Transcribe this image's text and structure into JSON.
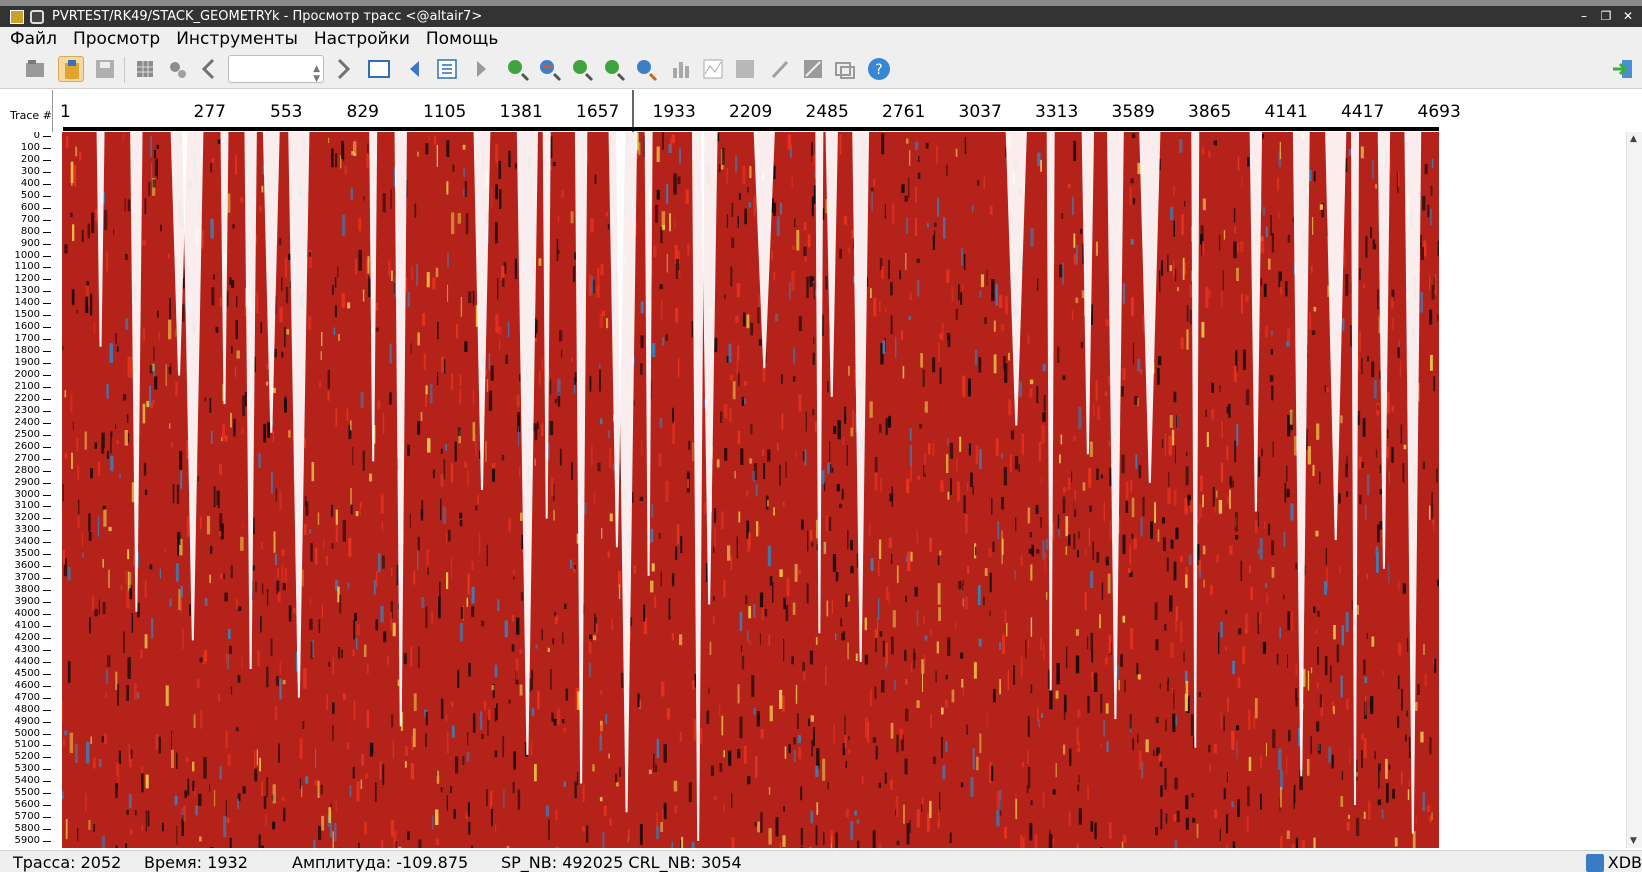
{
  "window": {
    "title": "PVRTEST/RK49/STACK_GEOMETRYk - Просмотр трасс <@altair7>",
    "buttons": [
      "–",
      "❐",
      "✕"
    ]
  },
  "menu": [
    "Файл",
    "Просмотр",
    "Инструменты",
    "Настройки",
    "Помощь"
  ],
  "toolbar": {
    "combo_value": "",
    "icons": [
      "open-folder-icon",
      "import-icon",
      "save-icon",
      "grid-icon",
      "settings-icon",
      "chevron-left-icon",
      "chevron-right-icon",
      "window-icon",
      "play-back-icon",
      "list-icon",
      "play-forward-icon",
      "zoom-in-icon",
      "zoom-out-icon",
      "zoom-up-icon",
      "zoom-fit-icon",
      "zoom-reset-icon",
      "bar-chart-icon",
      "spectrum-icon",
      "image-icon",
      "pick-icon",
      "edit-icon",
      "overlay-icon",
      "help-icon",
      "exit-icon"
    ]
  },
  "trace_axis": {
    "label": "Trace #",
    "ticks": [
      "1",
      "277",
      "553",
      "829",
      "1105",
      "1381",
      "1657",
      "1933",
      "2209",
      "2485",
      "2761",
      "3037",
      "3313",
      "3589",
      "3865",
      "4141",
      "4417",
      "4693"
    ]
  },
  "time_axis": {
    "ticks": [
      "0",
      "100",
      "200",
      "300",
      "400",
      "500",
      "600",
      "700",
      "800",
      "900",
      "1000",
      "1100",
      "1200",
      "1300",
      "1400",
      "1500",
      "1600",
      "1700",
      "1800",
      "1900",
      "2000",
      "2100",
      "2200",
      "2300",
      "2400",
      "2500",
      "2600",
      "2700",
      "2800",
      "2900",
      "3000",
      "3100",
      "3200",
      "3300",
      "3400",
      "3500",
      "3600",
      "3700",
      "3800",
      "3900",
      "4000",
      "4100",
      "4200",
      "4300",
      "4400",
      "4500",
      "4600",
      "4700",
      "4800",
      "4900",
      "5000",
      "5100",
      "5200",
      "5300",
      "5400",
      "5500",
      "5600",
      "5700",
      "5800",
      "5900"
    ]
  },
  "plot": {
    "colors": {
      "dominant": "#b5221a",
      "dark": "#1a0a0a",
      "bright": "#e8331e",
      "accent_blue": "#3d7fb8",
      "accent_yellow": "#e9c44a",
      "gap": "#ffffff"
    },
    "gap_fractions": [
      0.028,
      0.054,
      0.085,
      0.095,
      0.118,
      0.137,
      0.152,
      0.172,
      0.226,
      0.246,
      0.305,
      0.338,
      0.352,
      0.377,
      0.403,
      0.41,
      0.426,
      0.462,
      0.47,
      0.51,
      0.55,
      0.559,
      0.58,
      0.693,
      0.718,
      0.745,
      0.765,
      0.79,
      0.823,
      0.867,
      0.9,
      0.925,
      0.939,
      0.96,
      0.981
    ]
  },
  "status": {
    "trace": "Трасса: 2052",
    "time": "Время: 1932",
    "amplitude": "Амплитуда: -109.875",
    "sp_crl": "SP_NB: 492025 CRL_NB: 3054",
    "right": "XDB"
  }
}
